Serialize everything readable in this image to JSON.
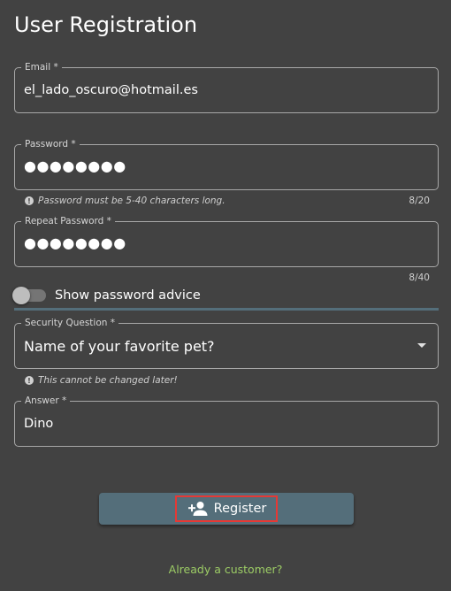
{
  "page": {
    "title": "User Registration"
  },
  "email": {
    "label": "Email *",
    "value": "el_lado_oscuro@hotmail.es"
  },
  "password": {
    "label": "Password *",
    "masked_value": "●●●●●●●●",
    "hint": "Password must be 5-40 characters long.",
    "counter": "8/20"
  },
  "repeat_password": {
    "label": "Repeat Password *",
    "masked_value": "●●●●●●●●",
    "counter": "8/40"
  },
  "password_advice": {
    "label": "Show password advice",
    "enabled": false
  },
  "security_question": {
    "label": "Security Question *",
    "selected": "Name of your favorite pet?",
    "hint": "This cannot be changed later!"
  },
  "answer": {
    "label": "Answer *",
    "value": "Dino"
  },
  "register_button": {
    "label": "Register"
  },
  "customer_link": {
    "label": "Already a customer?"
  },
  "colors": {
    "background": "#424242",
    "accent": "#546e7a",
    "link": "#9ccc65",
    "highlight": "#e53935"
  },
  "icons": {
    "register": "person-add-icon",
    "info": "info-icon",
    "dropdown": "caret-down-icon"
  }
}
